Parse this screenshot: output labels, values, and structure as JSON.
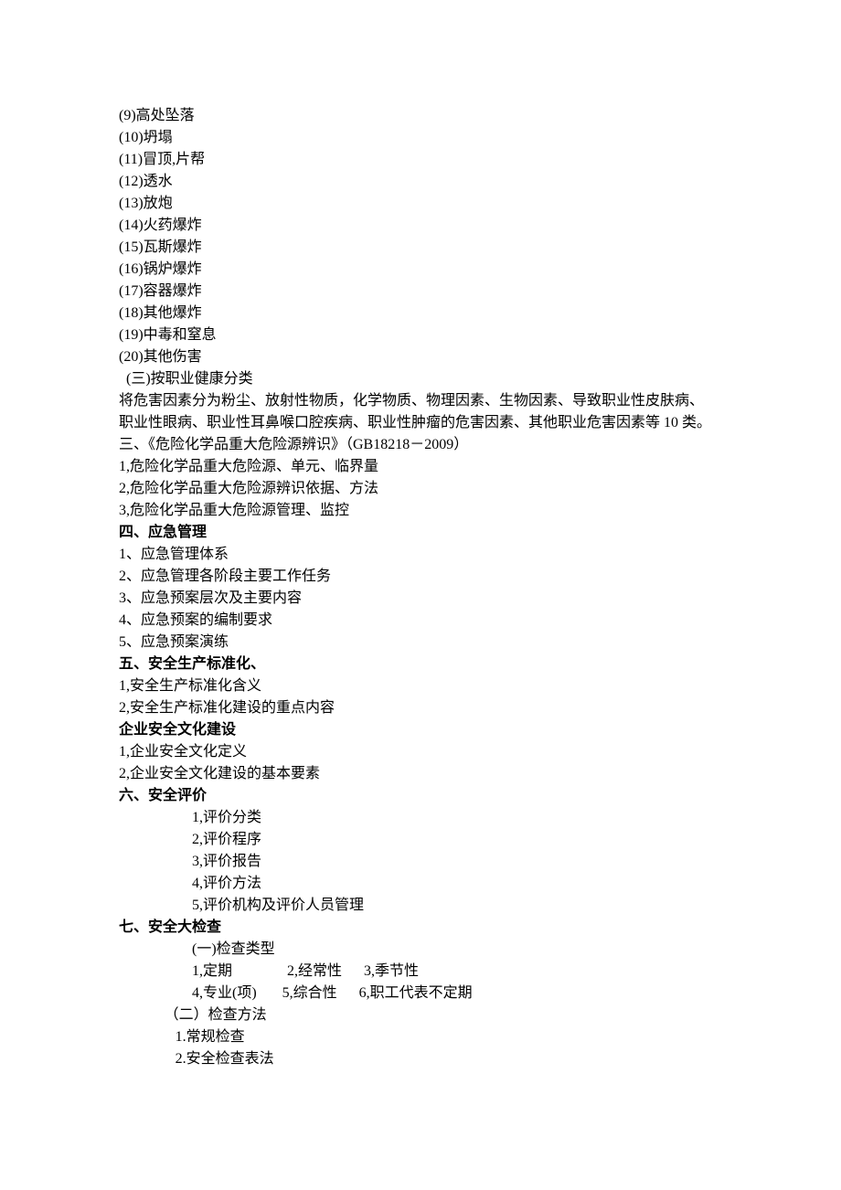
{
  "lines": [
    {
      "text": "(9)高处坠落",
      "cls": ""
    },
    {
      "text": "(10)坍塌",
      "cls": ""
    },
    {
      "text": "(11)冒顶,片帮",
      "cls": ""
    },
    {
      "text": "(12)透水",
      "cls": ""
    },
    {
      "text": "(13)放炮",
      "cls": ""
    },
    {
      "text": "(14)火药爆炸",
      "cls": ""
    },
    {
      "text": "(15)瓦斯爆炸",
      "cls": ""
    },
    {
      "text": "(16)锅炉爆炸",
      "cls": ""
    },
    {
      "text": "(17)容器爆炸",
      "cls": ""
    },
    {
      "text": "(18)其他爆炸",
      "cls": ""
    },
    {
      "text": "(19)中毒和窒息",
      "cls": ""
    },
    {
      "text": "(20)其他伤害",
      "cls": ""
    },
    {
      "text": "  (三)按职业健康分类",
      "cls": ""
    },
    {
      "text": "将危害因素分为粉尘、放射性物质，化学物质、物理因素、生物因素、导致职业性皮肤病、",
      "cls": ""
    },
    {
      "text": "职业性眼病、职业性耳鼻喉口腔疾病、职业性肿瘤的危害因素、其他职业危害因素等 10 类。",
      "cls": ""
    },
    {
      "text": "三、《危险化学品重大危险源辨识》（GB18218－2009）",
      "cls": ""
    },
    {
      "text": "1,危险化学品重大危险源、单元、临界量",
      "cls": ""
    },
    {
      "text": "2,危险化学品重大危险源辨识依据、方法",
      "cls": ""
    },
    {
      "text": "3,危险化学品重大危险源管理、监控",
      "cls": ""
    },
    {
      "text": "四、应急管理",
      "cls": "bold"
    },
    {
      "text": "1、应急管理体系",
      "cls": ""
    },
    {
      "text": "2、应急管理各阶段主要工作任务",
      "cls": ""
    },
    {
      "text": "3、应急预案层次及主要内容",
      "cls": ""
    },
    {
      "text": "4、应急预案的编制要求",
      "cls": ""
    },
    {
      "text": "5、应急预案演练",
      "cls": ""
    },
    {
      "text": "五、安全生产标准化、",
      "cls": "bold"
    },
    {
      "text": "1,安全生产标准化含义",
      "cls": ""
    },
    {
      "text": "2,安全生产标准化建设的重点内容",
      "cls": ""
    },
    {
      "text": "企业安全文化建设",
      "cls": "bold"
    },
    {
      "text": "1,企业安全文化定义",
      "cls": ""
    },
    {
      "text": "2,企业安全文化建设的基本要素",
      "cls": ""
    },
    {
      "text": "六、安全评价",
      "cls": "bold"
    },
    {
      "text": "1,评价分类",
      "cls": "indent-list"
    },
    {
      "text": "2,评价程序",
      "cls": "indent-list"
    },
    {
      "text": "3,评价报告",
      "cls": "indent-list"
    },
    {
      "text": "4,评价方法",
      "cls": "indent-list"
    },
    {
      "text": "5,评价机构及评价人员管理",
      "cls": "indent-list"
    },
    {
      "text": "七、安全大检查",
      "cls": "bold"
    },
    {
      "text": "(一)检查类型",
      "cls": "indent-list"
    },
    {
      "text": "1,定期               2,经常性      3,季节性",
      "cls": "indent-list"
    },
    {
      "text": "4,专业(项)       5,综合性      6,职工代表不定期",
      "cls": "indent-list"
    },
    {
      "text": "（二）检查方法",
      "cls": "indent-list2"
    },
    {
      "text": " 1.常规检查",
      "cls": "indent-list3"
    },
    {
      "text": " 2.安全检查表法",
      "cls": "indent-list3"
    }
  ]
}
